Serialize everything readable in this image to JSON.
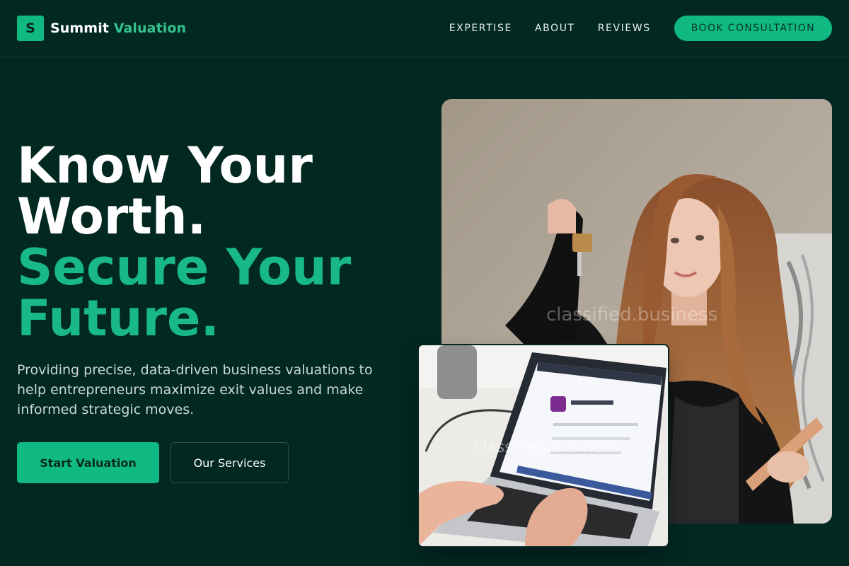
{
  "brand": {
    "mark": "S",
    "name_part1": "Summit",
    "name_part2": "Valuation"
  },
  "nav": {
    "links": [
      "EXPERTISE",
      "ABOUT",
      "REVIEWS"
    ],
    "cta_label": "BOOK CONSULTATION"
  },
  "hero": {
    "title_lines": [
      "Know Your",
      "Worth."
    ],
    "title_accent_lines": [
      "Secure Your",
      "Future."
    ],
    "subtitle": "Providing precise, data-driven business valuations to help entrepreneurs maximize exit values and make informed strategic moves.",
    "primary_button": "Start Valuation",
    "secondary_button": "Our Services"
  },
  "images": {
    "main_watermark": "classified.business",
    "laptop_watermark": "classified.business"
  },
  "colors": {
    "background": "#022822",
    "accent": "#10b981",
    "accent_text": "#18b987"
  }
}
